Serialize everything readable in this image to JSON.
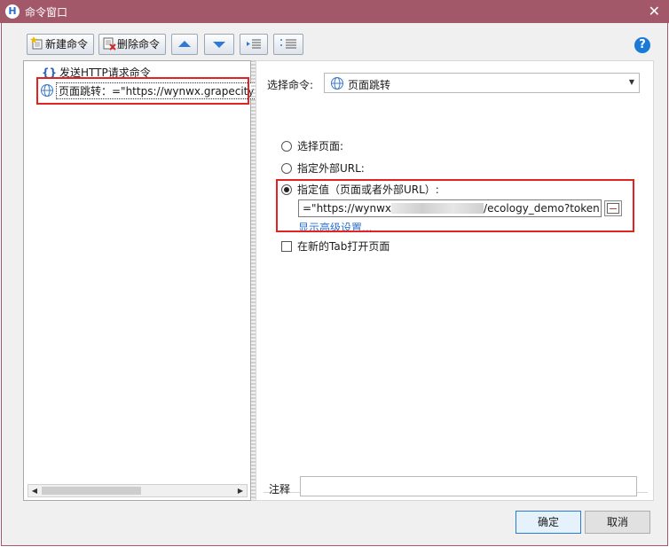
{
  "window": {
    "title": "命令窗口",
    "app_icon_letter": "H"
  },
  "toolbar": {
    "new_label": "新建命令",
    "delete_label": "删除命令"
  },
  "tree": {
    "items": [
      {
        "icon": "braces-icon",
        "glyph": "{}",
        "label": "发送HTTP请求命令"
      },
      {
        "icon": "globe-icon",
        "label": "页面跳转：=\"https://wynwx.grapecity"
      }
    ]
  },
  "command": {
    "select_label": "选择命令:",
    "selected_value": "页面跳转"
  },
  "options": {
    "select_page": "选择页面:",
    "external_url": "指定外部URL:",
    "specify_value": "指定值（页面或者外部URL）:",
    "selected_option": "specify_value",
    "url_prefix": "=\"https://wynwx",
    "url_suffix": "/ecology_demo?token=\"",
    "advanced_link": "显示高级设置...",
    "open_new_tab": "在新的Tab打开页面",
    "open_new_tab_checked": false
  },
  "note": {
    "label": "注释",
    "value": ""
  },
  "buttons": {
    "ok": "确定",
    "cancel": "取消"
  },
  "colors": {
    "titlebar": "#a3586a",
    "highlight": "#e02424",
    "link": "#2a6fd1",
    "help": "#1b7ad6"
  }
}
